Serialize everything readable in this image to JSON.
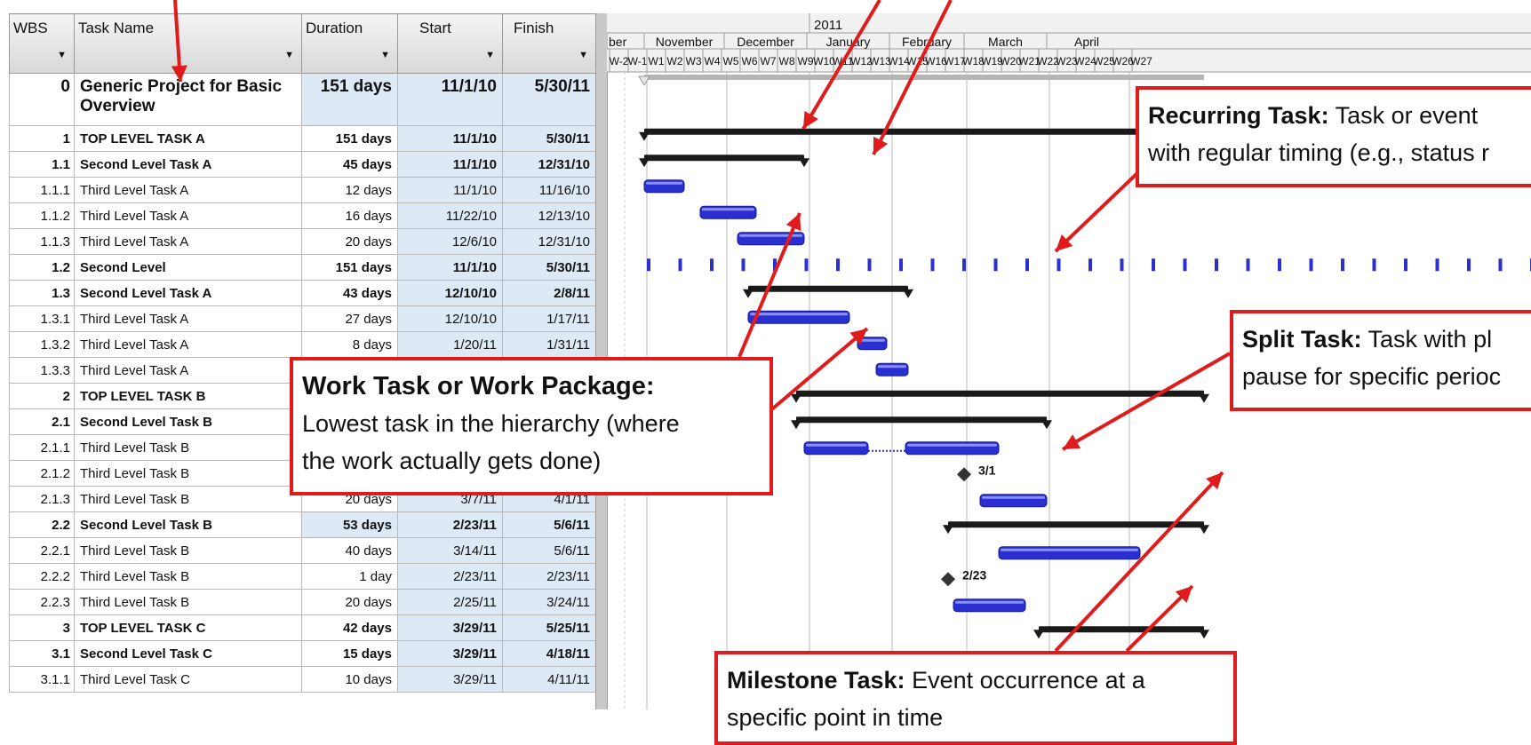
{
  "columns": {
    "wbs": "WBS",
    "task_name": "Task Name",
    "duration": "Duration",
    "start": "Start",
    "finish": "Finish"
  },
  "rows": [
    {
      "wbs": "0",
      "name": "Generic Project for Basic Overview",
      "duration": "151 days",
      "start": "11/1/10",
      "finish": "5/30/11",
      "level": "root",
      "bar": [
        "11/1/10",
        "5/30/11"
      ]
    },
    {
      "wbs": "1",
      "name": "TOP LEVEL TASK A",
      "duration": "151 days",
      "start": "11/1/10",
      "finish": "5/30/11",
      "level": "summary",
      "bar": [
        "11/1/10",
        "5/30/11"
      ]
    },
    {
      "wbs": "1.1",
      "name": "Second Level Task A",
      "duration": "45 days",
      "start": "11/1/10",
      "finish": "12/31/10",
      "level": "summary",
      "bar": [
        "11/1/10",
        "12/31/10"
      ]
    },
    {
      "wbs": "1.1.1",
      "name": "Third Level Task A",
      "duration": "12 days",
      "start": "11/1/10",
      "finish": "11/16/10",
      "level": "task",
      "bar": [
        "11/1/10",
        "11/16/10"
      ]
    },
    {
      "wbs": "1.1.2",
      "name": "Third Level Task A",
      "duration": "16 days",
      "start": "11/22/10",
      "finish": "12/13/10",
      "level": "task",
      "bar": [
        "11/22/10",
        "12/13/10"
      ]
    },
    {
      "wbs": "1.1.3",
      "name": "Third Level Task A",
      "duration": "20 days",
      "start": "12/6/10",
      "finish": "12/31/10",
      "level": "task",
      "bar": [
        "12/6/10",
        "12/31/10"
      ]
    },
    {
      "wbs": "1.2",
      "name": "Second Level",
      "duration": "151 days",
      "start": "11/1/10",
      "finish": "5/30/11",
      "level": "summary",
      "recurring": true
    },
    {
      "wbs": "1.3",
      "name": "Second Level Task A",
      "duration": "43 days",
      "start": "12/10/10",
      "finish": "2/8/11",
      "level": "summary",
      "bar": [
        "12/10/10",
        "2/8/11"
      ]
    },
    {
      "wbs": "1.3.1",
      "name": "Third Level Task A",
      "duration": "27 days",
      "start": "12/10/10",
      "finish": "1/17/11",
      "level": "task",
      "bar": [
        "12/10/10",
        "1/17/11"
      ]
    },
    {
      "wbs": "1.3.2",
      "name": "Third Level Task A",
      "duration": "8 days",
      "start": "1/20/11",
      "finish": "1/31/11",
      "level": "task",
      "bar": [
        "1/20/11",
        "1/31/11"
      ]
    },
    {
      "wbs": "1.3.3",
      "name": "Third Level Task A",
      "duration": "",
      "start": "",
      "finish": "",
      "level": "task",
      "bar": [
        "1/27/11",
        "2/8/11"
      ]
    },
    {
      "wbs": "2",
      "name": "TOP LEVEL TASK B",
      "duration": "",
      "start": "",
      "finish": "",
      "level": "summary",
      "bar": [
        "12/28/10",
        "5/30/11"
      ]
    },
    {
      "wbs": "2.1",
      "name": "Second Level Task B",
      "duration": "",
      "start": "",
      "finish": "",
      "level": "summary",
      "bar": [
        "12/28/10",
        "4/1/11"
      ]
    },
    {
      "wbs": "2.1.1",
      "name": "Third Level Task B",
      "duration": "",
      "start": "",
      "finish": "",
      "level": "task",
      "split": [
        [
          "12/31/10",
          "1/24/11"
        ],
        [
          "2/7/11",
          "3/14/11"
        ]
      ]
    },
    {
      "wbs": "2.1.2",
      "name": "Third Level Task B",
      "duration": "",
      "start": "",
      "finish": "",
      "level": "milestone",
      "milestone": "3/1/11",
      "label": "3/1"
    },
    {
      "wbs": "2.1.3",
      "name": "Third Level Task B",
      "duration": "20 days",
      "start": "3/7/11",
      "finish": "4/1/11",
      "level": "task",
      "bar": [
        "3/7/11",
        "4/1/11"
      ]
    },
    {
      "wbs": "2.2",
      "name": "Second Level Task B",
      "duration": "53 days",
      "start": "2/23/11",
      "finish": "5/6/11",
      "level": "summary",
      "bar": [
        "2/23/11",
        "5/30/11"
      ]
    },
    {
      "wbs": "2.2.1",
      "name": "Third Level Task B",
      "duration": "40 days",
      "start": "3/14/11",
      "finish": "5/6/11",
      "level": "task",
      "bar": [
        "3/14/11",
        "5/6/11"
      ]
    },
    {
      "wbs": "2.2.2",
      "name": "Third Level Task B",
      "duration": "1 day",
      "start": "2/23/11",
      "finish": "2/23/11",
      "level": "milestone",
      "milestone": "2/23/11",
      "label": "2/23"
    },
    {
      "wbs": "2.2.3",
      "name": "Third Level Task B",
      "duration": "20 days",
      "start": "2/25/11",
      "finish": "3/24/11",
      "level": "task",
      "bar": [
        "2/25/11",
        "3/24/11"
      ]
    },
    {
      "wbs": "3",
      "name": "TOP LEVEL TASK C",
      "duration": "42 days",
      "start": "3/29/11",
      "finish": "5/25/11",
      "level": "summary",
      "bar": [
        "3/29/11",
        "5/30/11"
      ]
    },
    {
      "wbs": "3.1",
      "name": "Second Level Task C",
      "duration": "15 days",
      "start": "3/29/11",
      "finish": "4/18/11",
      "level": "summary",
      "bar": [
        "3/29/11",
        "4/18/11"
      ]
    },
    {
      "wbs": "3.1.1",
      "name": "Third Level Task C",
      "duration": "10 days",
      "start": "3/29/11",
      "finish": "4/11/11",
      "level": "task",
      "bar": [
        "3/29/11",
        "4/11/11"
      ]
    }
  ],
  "timescale": {
    "year": "2011",
    "months": [
      "ber",
      "November",
      "December",
      "January",
      "February",
      "March",
      "April"
    ],
    "weeks": [
      "W-2",
      "W-1",
      "W1",
      "W2",
      "W3",
      "W4",
      "W5",
      "W6",
      "W7",
      "W8",
      "W9",
      "W10",
      "W11",
      "W12",
      "W13",
      "W14",
      "W15",
      "W16",
      "W17",
      "W18",
      "W19",
      "W20",
      "W21",
      "W22",
      "W23",
      "W24",
      "W25",
      "W26",
      "W27"
    ],
    "timeline_start": "10/18/10"
  },
  "callouts": {
    "recurring": {
      "title": "Recurring Task:",
      "body1": " Task or event",
      "body2": "with regular timing (e.g., status r"
    },
    "split": {
      "title": "Split Task:",
      "body1": " Task with pl",
      "body2": "pause for specific perioc"
    },
    "work": {
      "title": "Work Task or Work Package:",
      "body1": "Lowest task in the hierarchy (where",
      "body2": "the work actually gets done)"
    },
    "milestone": {
      "title": "Milestone Task:",
      "body1": " Event occurrence at a",
      "body2": "specific point in time"
    }
  },
  "colors": {
    "bar": "#2a2fd0",
    "summary": "#1a1a1a",
    "callout_border": "#e01b1b",
    "date_cell": "#ddeaf6",
    "pointer": "#e01b1b"
  }
}
